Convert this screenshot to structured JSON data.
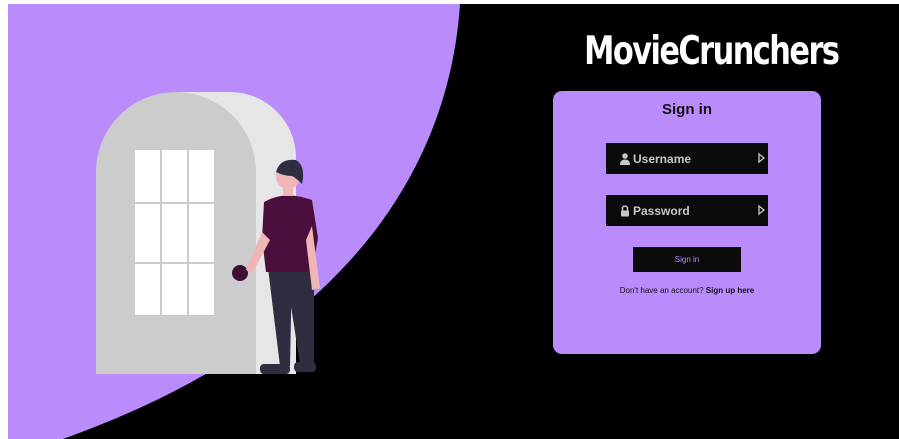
{
  "app": {
    "brand": "MovieCrunchers"
  },
  "login": {
    "title": "Sign in",
    "username_placeholder": "Username",
    "password_placeholder": "Password",
    "submit_label": "Sign in",
    "signup_prompt": "Don't have an account?",
    "signup_link": "Sign up here"
  },
  "theme": {
    "accent": "#b98bfb",
    "background": "#000000",
    "field_bg": "#0b0b0b",
    "door": "#cccccc",
    "shirt": "#4b0f3e",
    "pants": "#2f2e41"
  },
  "icons": {
    "username": "user-icon",
    "password": "lock-icon",
    "field_end": "arrow-right-icon"
  }
}
